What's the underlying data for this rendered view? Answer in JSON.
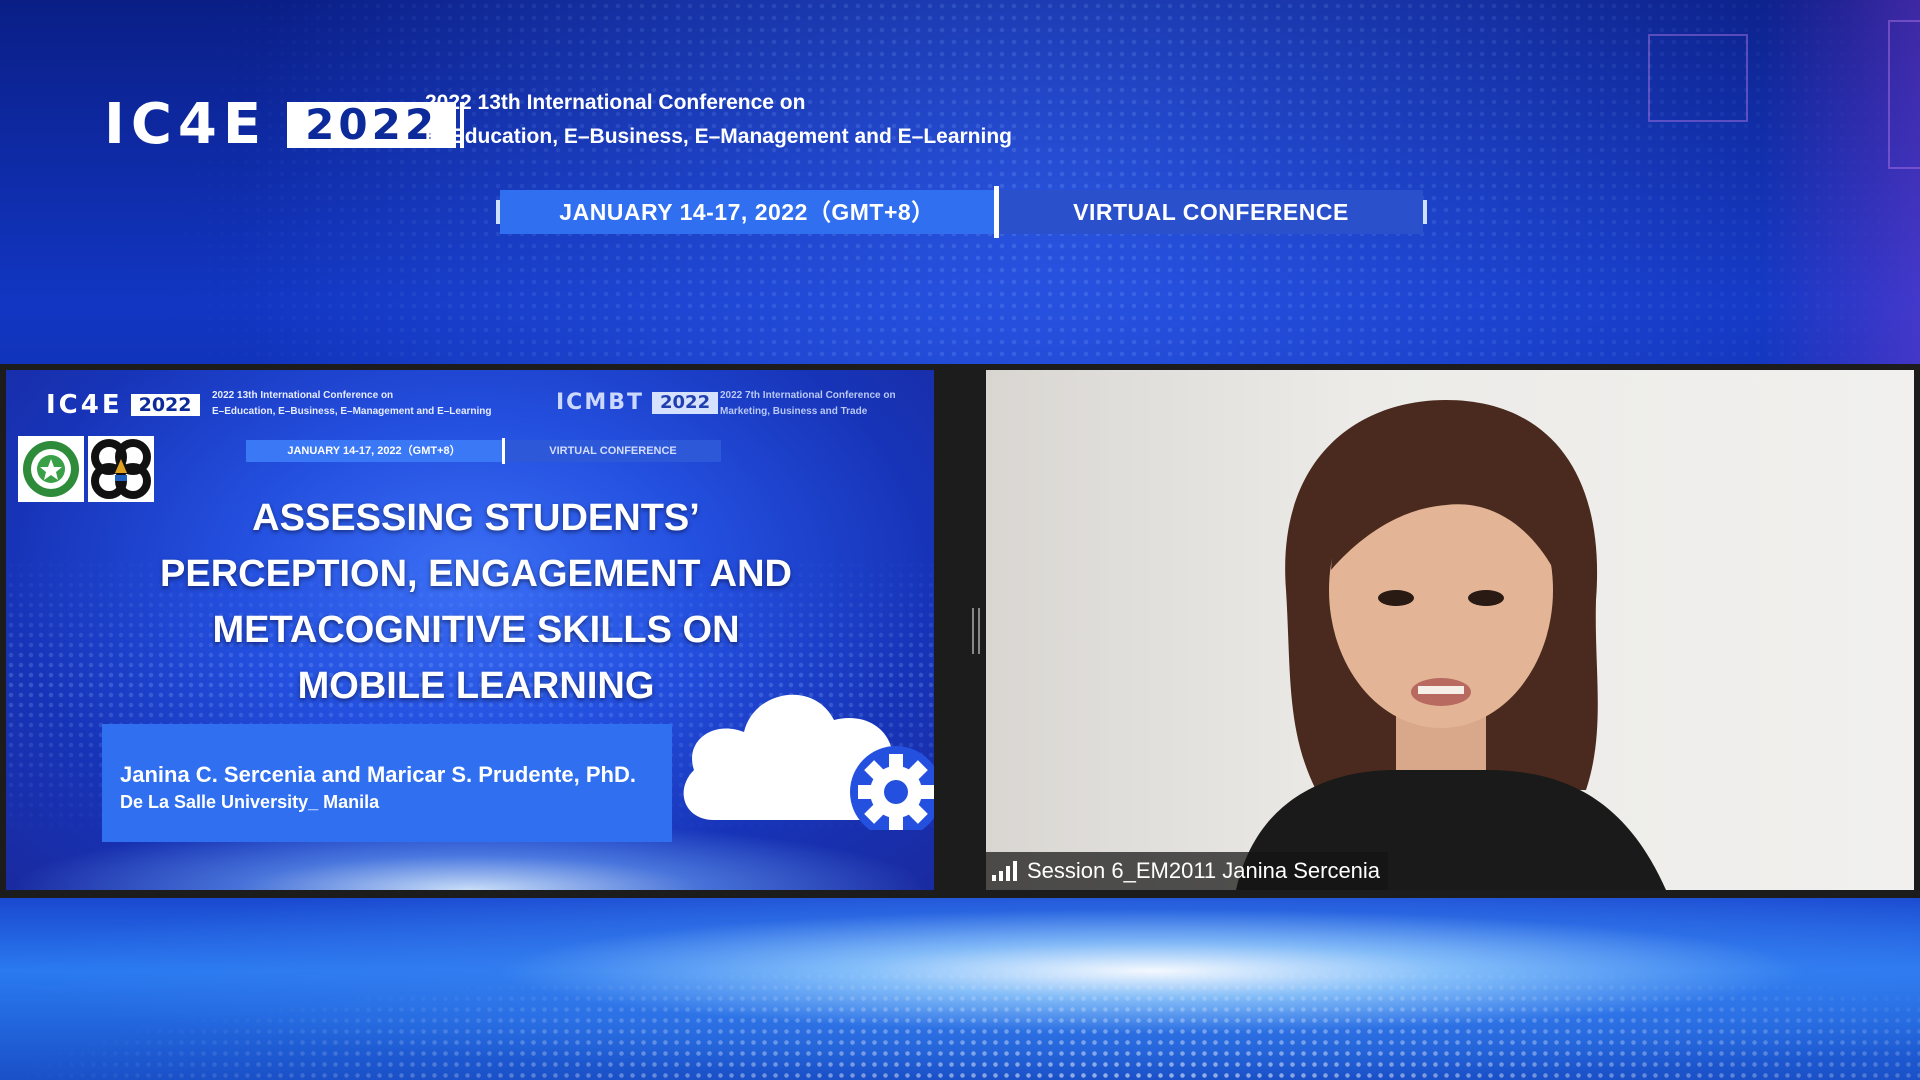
{
  "header": {
    "logo_text": "IC4E",
    "logo_year": "2022",
    "conference_line1": "2022 13th International Conference on",
    "conference_line2": "E–Education, E–Business, E–Management and E–Learning",
    "date_label": "JANUARY 14-17, 2022（GMT+8）",
    "format_label": "VIRTUAL CONFERENCE"
  },
  "shared_slide": {
    "logo1_text": "IC4E",
    "logo1_year": "2022",
    "logo1_sub1": "2022 13th International Conference on",
    "logo1_sub2": "E–Education, E–Business, E–Management and E–Learning",
    "logo2_text": "ICMBT",
    "logo2_year": "2022",
    "logo2_sub1": "2022 7th International Conference on",
    "logo2_sub2": "Marketing, Business and Trade",
    "date_label": "JANUARY 14-17, 2022（GMT+8）",
    "format_label": "VIRTUAL CONFERENCE",
    "title_lines": [
      "ASSESSING STUDENTS’",
      "PERCEPTION, ENGAGEMENT AND",
      "METACOGNITIVE SKILLS ON",
      "MOBILE LEARNING"
    ],
    "authors": "Janina C. Sercenia and Maricar S. Prudente, PhD.",
    "affiliation": "De La Salle University_ Manila"
  },
  "participant": {
    "name_tag": "Session 6_EM2011 Janina Sercenia",
    "signal_icon": "signal-bars-icon"
  },
  "colors": {
    "background": "#1236c2",
    "pill_blue": "#2f6ff0",
    "pill_dark": "#2a50cc",
    "panel_bg": "#1c1c1c"
  }
}
